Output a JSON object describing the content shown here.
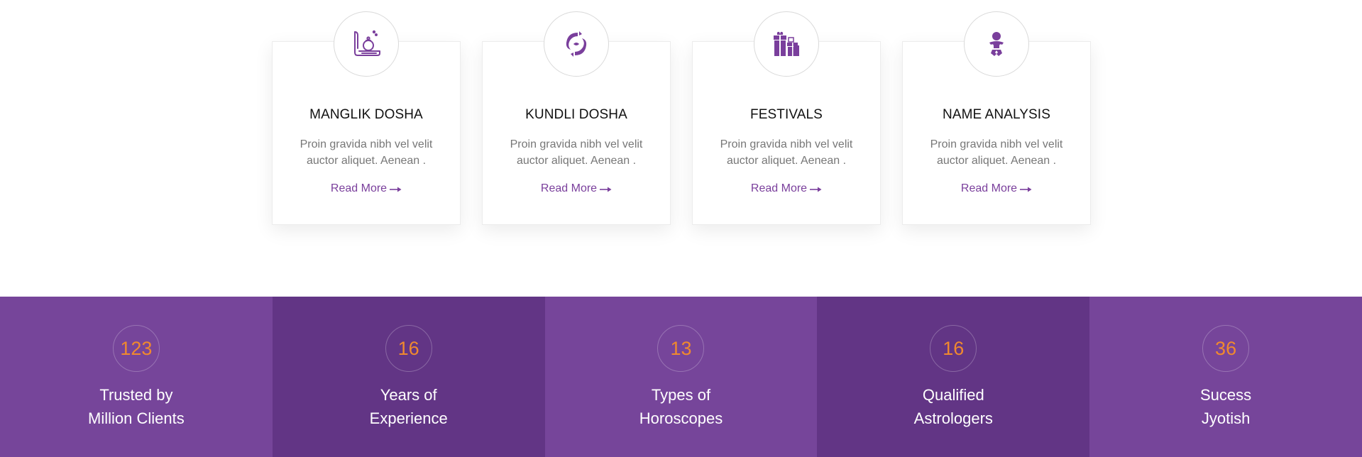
{
  "services": {
    "cards": [
      {
        "icon": "hand-crystal-ball-icon",
        "title": "MANGLIK DOSHA",
        "description": "Proin gravida nibh vel velit auctor aliquet. Aenean .",
        "link": "Read More"
      },
      {
        "icon": "pisces-icon",
        "title": "KUNDLI DOSHA",
        "description": "Proin gravida nibh vel velit auctor aliquet. Aenean .",
        "link": "Read More"
      },
      {
        "icon": "gift-boxes-icon",
        "title": "FESTIVALS",
        "description": "Proin gravida nibh vel velit auctor aliquet. Aenean .",
        "link": "Read More"
      },
      {
        "icon": "baby-icon",
        "title": "NAME ANALYSIS",
        "description": "Proin gravida nibh vel velit auctor aliquet. Aenean .",
        "link": "Read More"
      }
    ]
  },
  "stats": [
    {
      "value": "123",
      "line1": "Trusted by",
      "line2": "Million Clients"
    },
    {
      "value": "16",
      "line1": "Years of",
      "line2": "Experience"
    },
    {
      "value": "13",
      "line1": "Types of",
      "line2": "Horoscopes"
    },
    {
      "value": "16",
      "line1": "Qualified",
      "line2": "Astrologers"
    },
    {
      "value": "36",
      "line1": "Sucess",
      "line2": "Jyotish"
    }
  ],
  "colors": {
    "accent_purple": "#7a3f9c",
    "stat_light": "#76459a",
    "stat_dark": "#623585",
    "stat_number": "#f0892e"
  }
}
